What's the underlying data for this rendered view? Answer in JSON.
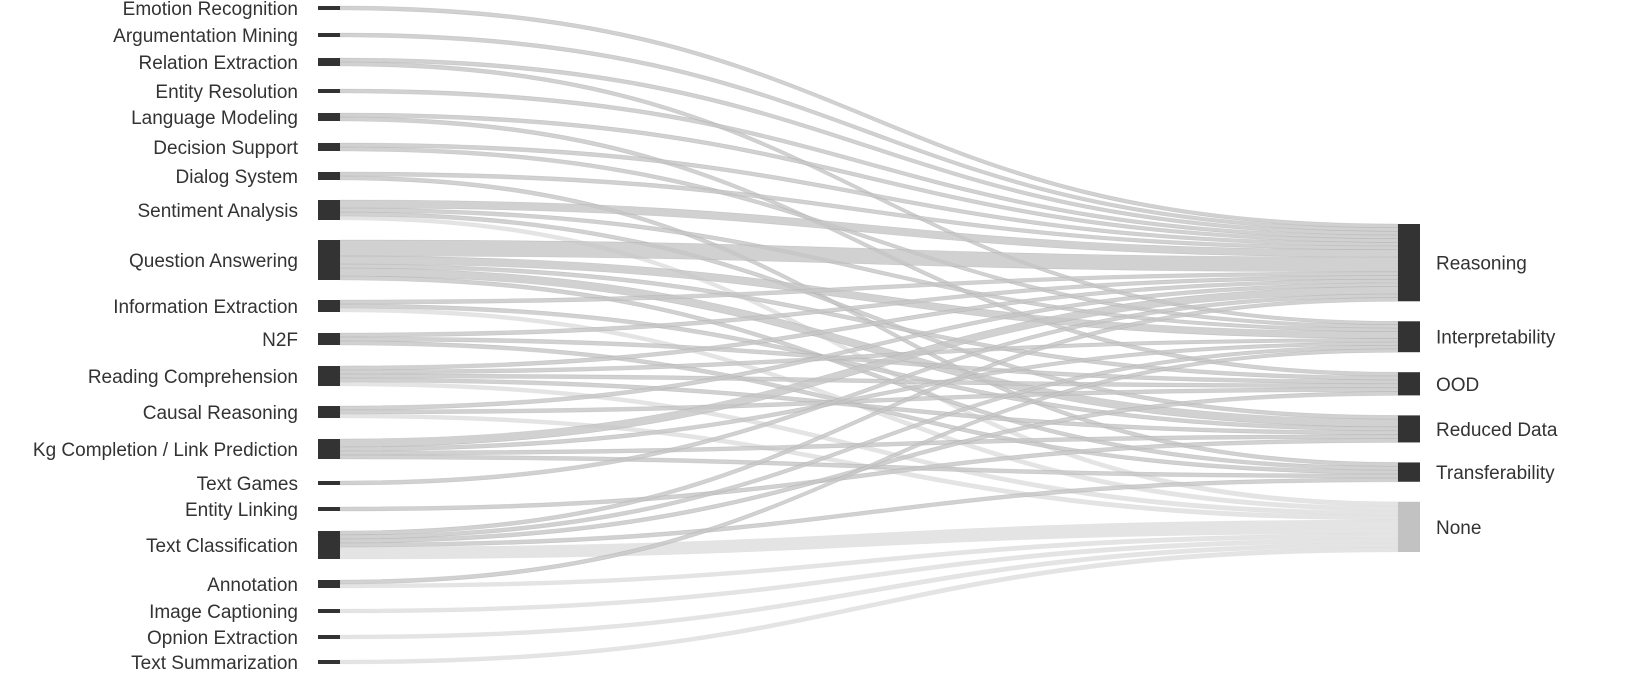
{
  "chart_data": {
    "type": "sankey",
    "title": "",
    "left_nodes": [
      {
        "name": "Emotion Recognition",
        "value": 1
      },
      {
        "name": "Argumentation Mining",
        "value": 1
      },
      {
        "name": "Relation Extraction",
        "value": 2
      },
      {
        "name": "Entity Resolution",
        "value": 1
      },
      {
        "name": "Language Modeling",
        "value": 2
      },
      {
        "name": "Decision Support",
        "value": 2
      },
      {
        "name": "Dialog System",
        "value": 2
      },
      {
        "name": "Sentiment Analysis",
        "value": 5
      },
      {
        "name": "Question Answering",
        "value": 10
      },
      {
        "name": "Information Extraction",
        "value": 3
      },
      {
        "name": "N2F",
        "value": 3
      },
      {
        "name": "Reading Comprehension",
        "value": 5
      },
      {
        "name": "Causal Reasoning",
        "value": 3
      },
      {
        "name": "Kg Completion / Link Prediction",
        "value": 5
      },
      {
        "name": "Text Games",
        "value": 1
      },
      {
        "name": "Entity Linking",
        "value": 1
      },
      {
        "name": "Text Classification",
        "value": 7
      },
      {
        "name": "Annotation",
        "value": 2
      },
      {
        "name": "Image Captioning",
        "value": 1
      },
      {
        "name": "Opnion Extraction",
        "value": 1
      },
      {
        "name": "Text Summarization",
        "value": 1
      }
    ],
    "right_nodes": [
      {
        "name": "Reasoning",
        "value": 20
      },
      {
        "name": "Interpretability",
        "value": 8
      },
      {
        "name": "OOD",
        "value": 6
      },
      {
        "name": "Reduced Data",
        "value": 7
      },
      {
        "name": "Transferability",
        "value": 5
      },
      {
        "name": "None",
        "value": 13
      }
    ],
    "links": [
      {
        "source": "Emotion Recognition",
        "target": "Reasoning",
        "value": 1
      },
      {
        "source": "Argumentation Mining",
        "target": "Reasoning",
        "value": 1
      },
      {
        "source": "Relation Extraction",
        "target": "Reasoning",
        "value": 1
      },
      {
        "source": "Relation Extraction",
        "target": "Interpretability",
        "value": 1
      },
      {
        "source": "Entity Resolution",
        "target": "Reasoning",
        "value": 1
      },
      {
        "source": "Language Modeling",
        "target": "Reasoning",
        "value": 1
      },
      {
        "source": "Language Modeling",
        "target": "OOD",
        "value": 1
      },
      {
        "source": "Decision Support",
        "target": "Reasoning",
        "value": 1
      },
      {
        "source": "Decision Support",
        "target": "Interpretability",
        "value": 1
      },
      {
        "source": "Dialog System",
        "target": "Reasoning",
        "value": 1
      },
      {
        "source": "Dialog System",
        "target": "Transferability",
        "value": 1
      },
      {
        "source": "Sentiment Analysis",
        "target": "Reasoning",
        "value": 2
      },
      {
        "source": "Sentiment Analysis",
        "target": "Interpretability",
        "value": 1
      },
      {
        "source": "Sentiment Analysis",
        "target": "Reduced Data",
        "value": 1
      },
      {
        "source": "Sentiment Analysis",
        "target": "None",
        "value": 1
      },
      {
        "source": "Question Answering",
        "target": "Reasoning",
        "value": 4
      },
      {
        "source": "Question Answering",
        "target": "Interpretability",
        "value": 2
      },
      {
        "source": "Question Answering",
        "target": "OOD",
        "value": 1
      },
      {
        "source": "Question Answering",
        "target": "Reduced Data",
        "value": 2
      },
      {
        "source": "Question Answering",
        "target": "Transferability",
        "value": 1
      },
      {
        "source": "Information Extraction",
        "target": "Reasoning",
        "value": 1
      },
      {
        "source": "Information Extraction",
        "target": "Reduced Data",
        "value": 1
      },
      {
        "source": "Information Extraction",
        "target": "None",
        "value": 1
      },
      {
        "source": "N2F",
        "target": "Reasoning",
        "value": 1
      },
      {
        "source": "N2F",
        "target": "OOD",
        "value": 1
      },
      {
        "source": "N2F",
        "target": "Transferability",
        "value": 1
      },
      {
        "source": "Reading Comprehension",
        "target": "Reasoning",
        "value": 1
      },
      {
        "source": "Reading Comprehension",
        "target": "Interpretability",
        "value": 1
      },
      {
        "source": "Reading Comprehension",
        "target": "OOD",
        "value": 1
      },
      {
        "source": "Reading Comprehension",
        "target": "Reduced Data",
        "value": 1
      },
      {
        "source": "Reading Comprehension",
        "target": "None",
        "value": 1
      },
      {
        "source": "Causal Reasoning",
        "target": "Reasoning",
        "value": 1
      },
      {
        "source": "Causal Reasoning",
        "target": "OOD",
        "value": 1
      },
      {
        "source": "Causal Reasoning",
        "target": "None",
        "value": 1
      },
      {
        "source": "Kg Completion / Link Prediction",
        "target": "Reasoning",
        "value": 2
      },
      {
        "source": "Kg Completion / Link Prediction",
        "target": "Interpretability",
        "value": 1
      },
      {
        "source": "Kg Completion / Link Prediction",
        "target": "Reduced Data",
        "value": 1
      },
      {
        "source": "Kg Completion / Link Prediction",
        "target": "Transferability",
        "value": 1
      },
      {
        "source": "Text Games",
        "target": "Reasoning",
        "value": 1
      },
      {
        "source": "Entity Linking",
        "target": "Reduced Data",
        "value": 1
      },
      {
        "source": "Text Classification",
        "target": "Reasoning",
        "value": 1
      },
      {
        "source": "Text Classification",
        "target": "Interpretability",
        "value": 1
      },
      {
        "source": "Text Classification",
        "target": "OOD",
        "value": 1
      },
      {
        "source": "Text Classification",
        "target": "Transferability",
        "value": 1
      },
      {
        "source": "Text Classification",
        "target": "None",
        "value": 3
      },
      {
        "source": "Annotation",
        "target": "Interpretability",
        "value": 1
      },
      {
        "source": "Annotation",
        "target": "None",
        "value": 1
      },
      {
        "source": "Image Captioning",
        "target": "None",
        "value": 1
      },
      {
        "source": "Opnion Extraction",
        "target": "None",
        "value": 1
      },
      {
        "source": "Text Summarization",
        "target": "None",
        "value": 1
      }
    ],
    "colors": {
      "node": "#333333",
      "none_node": "#c2c2c2",
      "link": "#c6c6c6",
      "none_link": "#e3e3e3",
      "label": "#333333"
    }
  }
}
